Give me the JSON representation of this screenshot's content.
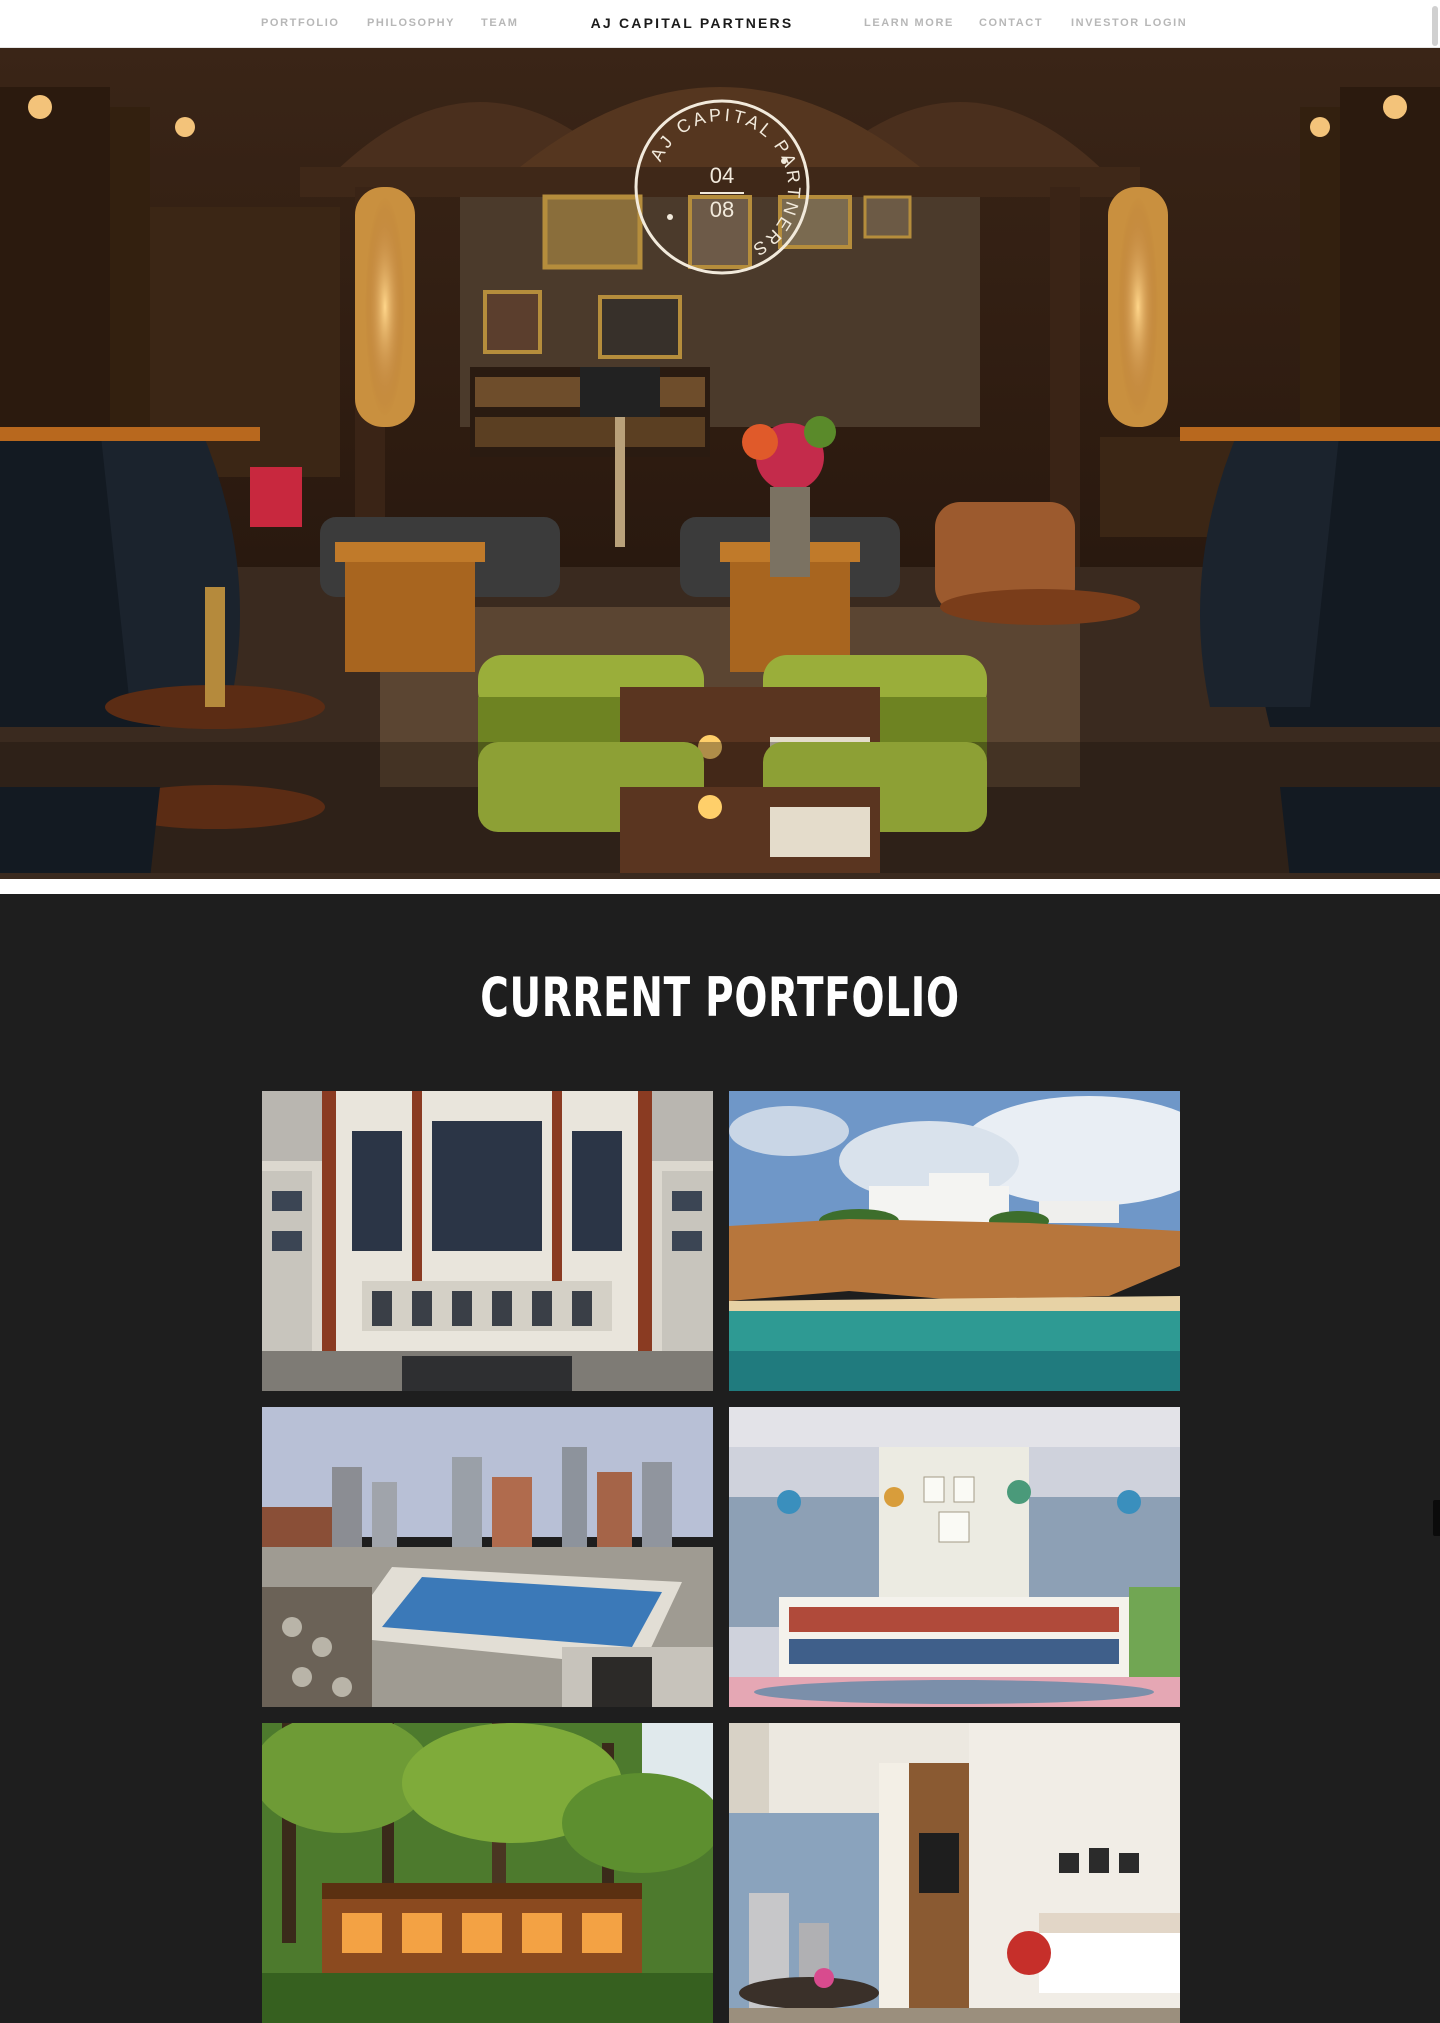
{
  "nav": {
    "left": [
      "PORTFOLIO",
      "PHILOSOPHY",
      "TEAM"
    ],
    "brand": "AJ CAPITAL PARTNERS",
    "right": [
      "LEARN MORE",
      "CONTACT",
      "INVESTOR LOGIN"
    ]
  },
  "hero": {
    "seal": {
      "ring_text": "AJ CAPITAL PARTNERS",
      "line1": "04",
      "line2": "08"
    }
  },
  "portfolio": {
    "title": "CURRENT PORTFOLIO",
    "tiles": [
      {
        "name": "gothic-building"
      },
      {
        "name": "cliffside-resort"
      },
      {
        "name": "rooftop-pool"
      },
      {
        "name": "library-lounge"
      },
      {
        "name": "forest-lodge"
      },
      {
        "name": "hotel-room"
      }
    ]
  },
  "colors": {
    "nav_bg": "#ffffff",
    "nav_link": "#b7b7b7",
    "brand": "#1b1b1b",
    "section_bg": "#1e1e1e",
    "title": "#ffffff"
  }
}
